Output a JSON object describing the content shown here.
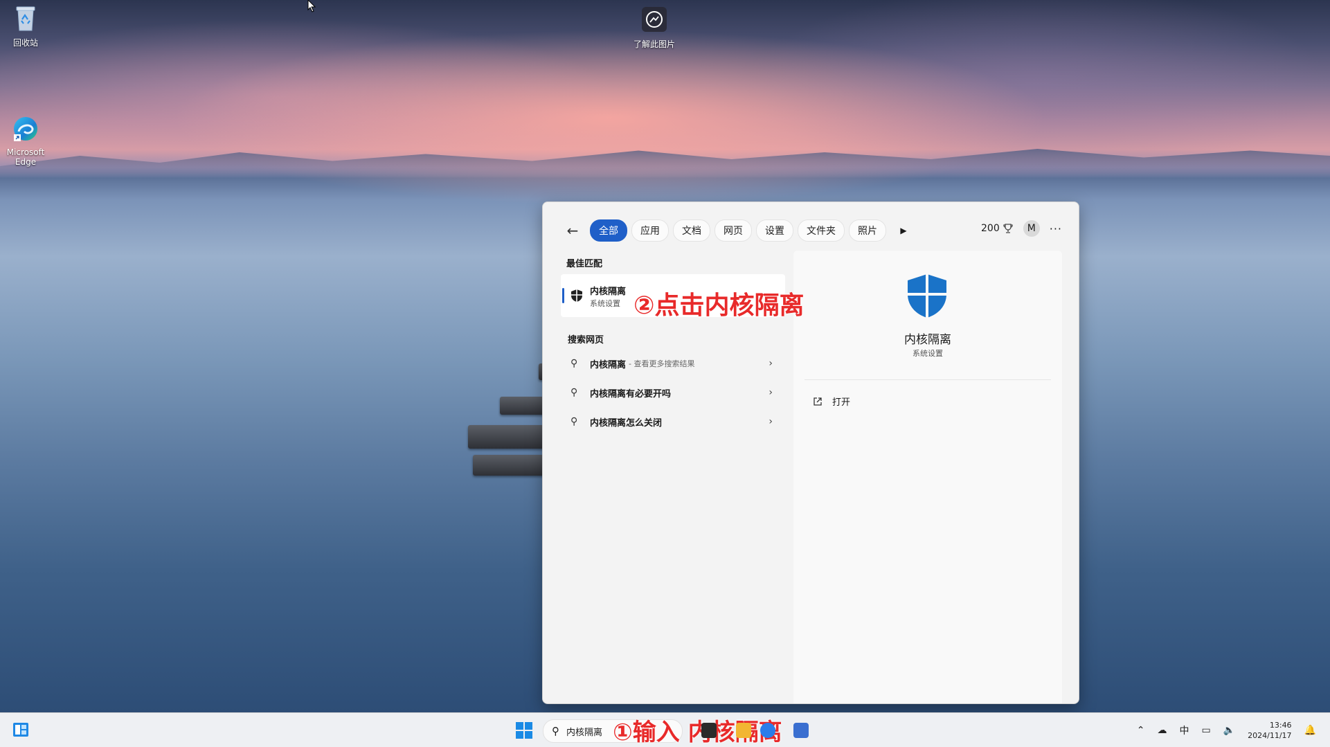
{
  "desktop": {
    "icons": [
      {
        "label": "回收站"
      },
      {
        "label": "Microsoft Edge"
      },
      {
        "label": "了解此图片"
      }
    ]
  },
  "search_panel": {
    "tabs": [
      "全部",
      "应用",
      "文档",
      "网页",
      "设置",
      "文件夹",
      "照片"
    ],
    "active_tab": "全部",
    "points": "200",
    "avatar_initial": "M",
    "best_match_heading": "最佳匹配",
    "best_match": {
      "title": "内核隔离",
      "subtitle": "系统设置"
    },
    "web_heading": "搜索网页",
    "web_results": [
      {
        "text": "内核隔离",
        "suffix": "- 查看更多搜索结果"
      },
      {
        "text": "内核隔离有必要开吗",
        "suffix": ""
      },
      {
        "text": "内核隔离怎么关闭",
        "suffix": ""
      }
    ],
    "detail": {
      "title": "内核隔离",
      "subtitle": "系统设置",
      "action": "打开"
    }
  },
  "annotations": {
    "step1": "①输入 内核隔离",
    "step2": "②点击内核隔离"
  },
  "taskbar": {
    "search_value": "内核隔离",
    "ime": "中",
    "time": "13:46",
    "date": "2024/11/17"
  },
  "colors": {
    "accent": "#1f5fc8",
    "annotation": "#e82a2a",
    "shield": "#1a73c8"
  }
}
